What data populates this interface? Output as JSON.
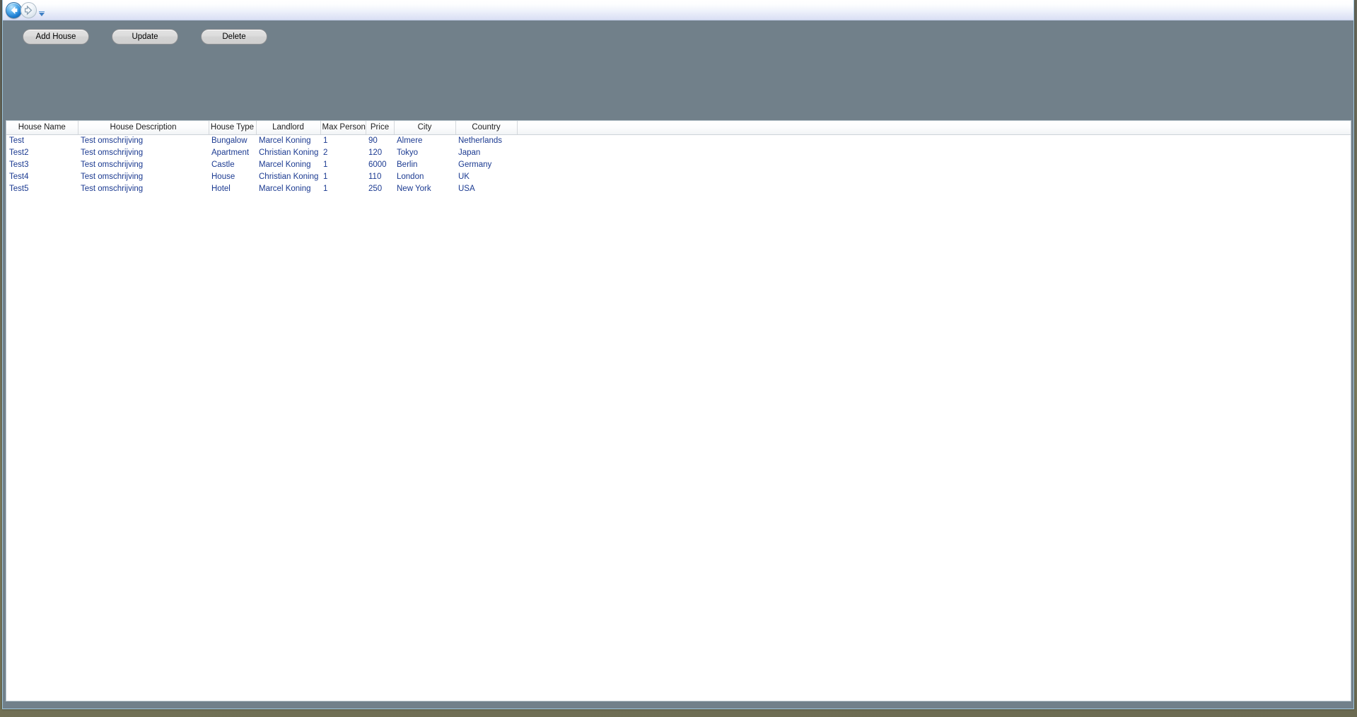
{
  "window": {
    "background_color": "#71808a",
    "border_color": "#9fc6dd"
  },
  "titlebar": {
    "back_icon": "back-arrow-icon",
    "forward_icon": "forward-arrow-icon",
    "dropdown_icon": "recent-pages-chevron-down-icon"
  },
  "toolbar": {
    "add_house_label": "Add House",
    "update_label": "Update",
    "delete_label": "Delete"
  },
  "grid": {
    "columns": [
      "House Name",
      "House Description",
      "House Type",
      "Landlord",
      "Max Person",
      "Price",
      "City",
      "Country",
      ""
    ],
    "rows": [
      {
        "house_name": "Test",
        "house_description": "Test omschrijving",
        "house_type": "Bungalow",
        "landlord": "Marcel Koning",
        "max_person": "1",
        "price": "90",
        "city": "Almere",
        "country": "Netherlands",
        "filler": ""
      },
      {
        "house_name": "Test2",
        "house_description": "Test omschrijving",
        "house_type": "Apartment",
        "landlord": "Christian Koning",
        "max_person": "2",
        "price": "120",
        "city": "Tokyo",
        "country": "Japan",
        "filler": ""
      },
      {
        "house_name": "Test3",
        "house_description": "Test omschrijving",
        "house_type": "Castle",
        "landlord": "Marcel Koning",
        "max_person": "1",
        "price": "6000",
        "city": "Berlin",
        "country": "Germany",
        "filler": ""
      },
      {
        "house_name": "Test4",
        "house_description": "Test omschrijving",
        "house_type": "House",
        "landlord": "Christian Koning",
        "max_person": "1",
        "price": "110",
        "city": "London",
        "country": "UK",
        "filler": ""
      },
      {
        "house_name": "Test5",
        "house_description": "Test omschrijving",
        "house_type": "Hotel",
        "landlord": "Marcel Koning",
        "max_person": "1",
        "price": "250",
        "city": "New York",
        "country": "USA",
        "filler": ""
      }
    ]
  }
}
